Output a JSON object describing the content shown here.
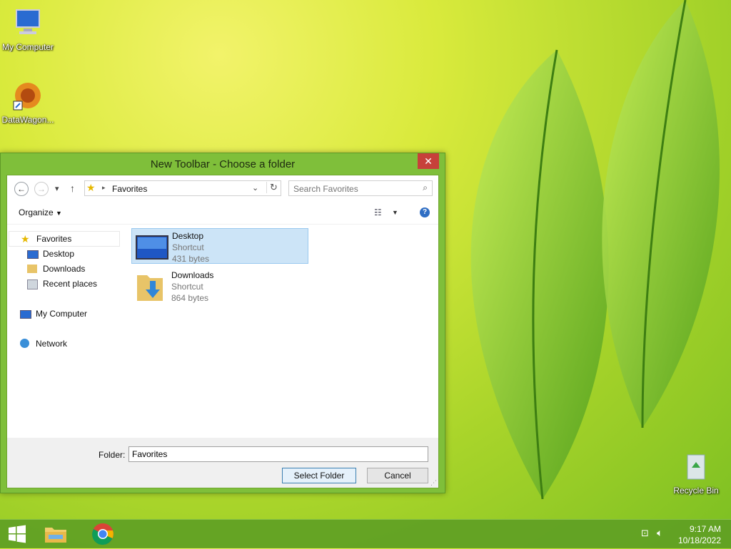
{
  "desktop": {
    "icons": [
      {
        "label": "My Computer",
        "icon": "computer-icon"
      },
      {
        "label": "DataWagon...",
        "icon": "datawagon-app-icon"
      },
      {
        "label": "Recycle Bin",
        "icon": "recycle-bin-icon"
      }
    ]
  },
  "dialog": {
    "title": "New Toolbar - Choose a folder",
    "close_glyph": "✕",
    "address": {
      "breadcrumb": "Favorites"
    },
    "search": {
      "placeholder": "Search Favorites"
    },
    "toolbar": {
      "organize_label": "Organize"
    },
    "nav_pane": [
      {
        "label": "Favorites",
        "icon": "favorites-star-icon"
      },
      {
        "label": "Desktop",
        "icon": "desktop-icon"
      },
      {
        "label": "Downloads",
        "icon": "downloads-icon"
      },
      {
        "label": "Recent places",
        "icon": "recent-places-icon"
      },
      {
        "label": "My Computer",
        "icon": "computer-icon"
      },
      {
        "label": "Network",
        "icon": "network-icon"
      }
    ],
    "files": [
      {
        "name": "Desktop",
        "type": "Shortcut",
        "size": "431 bytes",
        "icon": "desktop-icon",
        "selected": true
      },
      {
        "name": "Downloads",
        "type": "Shortcut",
        "size": "864 bytes",
        "icon": "downloads-folder-icon",
        "selected": false
      }
    ],
    "folder_label": "Folder:",
    "folder_value": "Favorites",
    "select_folder_label": "Select Folder",
    "cancel_label": "Cancel"
  },
  "taskbar": {
    "time": "9:17 AM",
    "date": "10/18/2022",
    "pinned": [
      "start-button",
      "file-explorer-icon",
      "chrome-icon"
    ]
  },
  "colors": {
    "accent": "#7fbf3a",
    "selection": "#cce4f7",
    "close_button": "#c7403a"
  }
}
